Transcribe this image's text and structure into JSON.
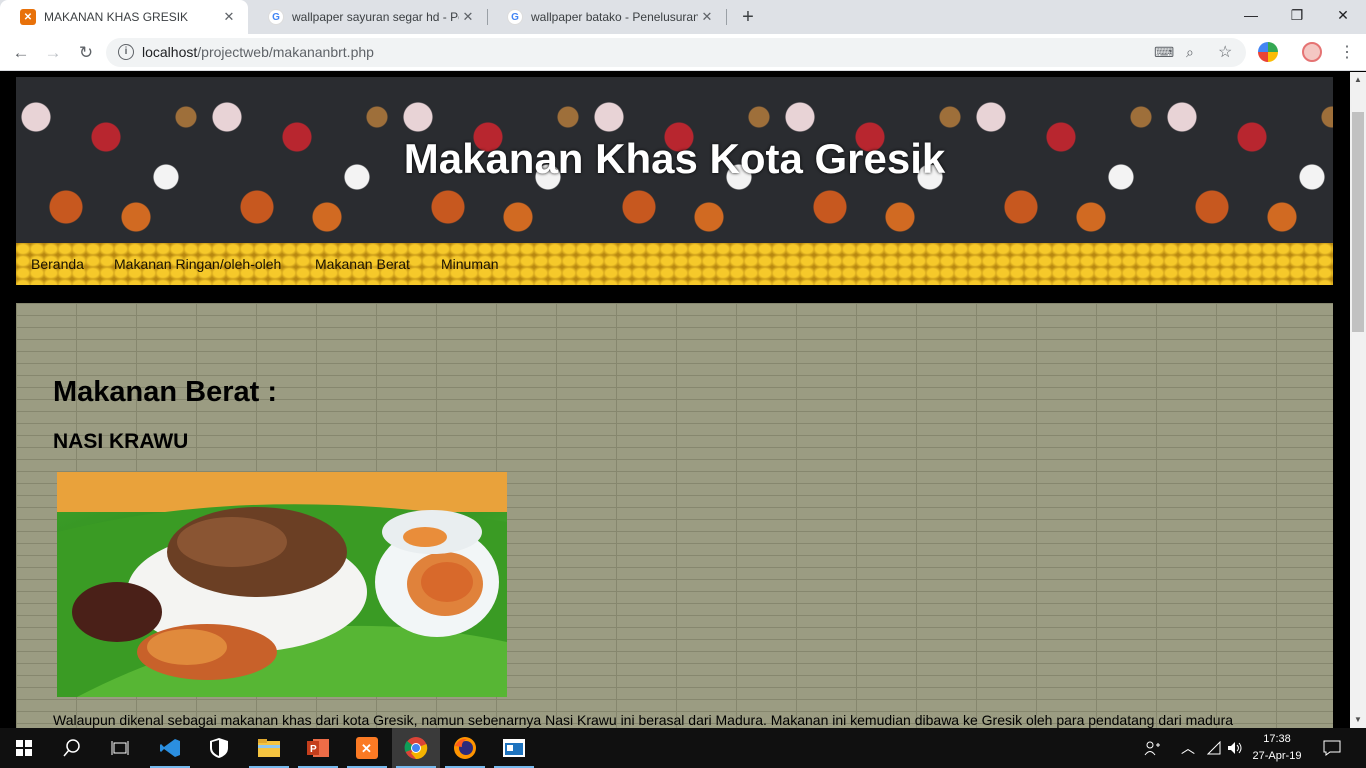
{
  "browser": {
    "tabs": [
      {
        "title": "MAKANAN KHAS GRESIK",
        "close": "✕",
        "active": true
      },
      {
        "title": "wallpaper sayuran segar hd - Pen",
        "close": "✕",
        "active": false
      },
      {
        "title": "wallpaper batako - Penelusuran G",
        "close": "✕",
        "active": false
      }
    ],
    "new_tab": "+",
    "window": {
      "minimize": "—",
      "restore": "❐",
      "close": "✕"
    },
    "url_host": "localhost",
    "url_path": "/projectweb/makananbrt.php"
  },
  "page": {
    "site_title": "Makanan Khas Kota Gresik",
    "menu": [
      "Beranda",
      "Makanan Ringan/oleh-oleh",
      "Makanan Berat",
      "Minuman"
    ],
    "heading": "Makanan Berat :",
    "dish_name": "NASI KRAWU",
    "description": "Walaupun dikenal sebagai makanan khas dari kota Gresik, namun sebenarnya Nasi Krawu ini berasal dari Madura. Makanan ini kemudian dibawa ke Gresik oleh para pendatang dari madura"
  },
  "taskbar": {
    "time": "17:38",
    "date": "27-Apr-19"
  }
}
